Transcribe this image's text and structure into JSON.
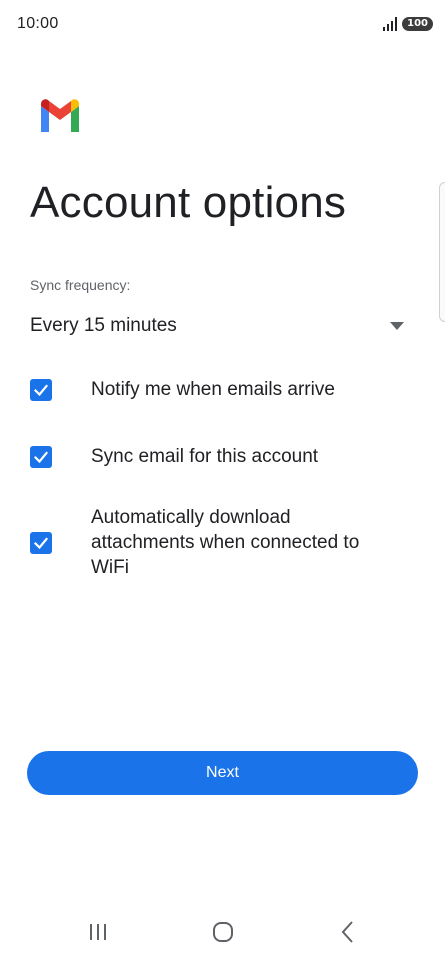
{
  "status_bar": {
    "time": "10:00",
    "battery": "100",
    "signal_icon": "signal-bars-icon"
  },
  "app": {
    "logo": "gmail-logo-icon",
    "brand_colors": [
      "#4285f4",
      "#ea4335",
      "#fbbc04",
      "#34a853",
      "#c5221f"
    ]
  },
  "page": {
    "title": "Account options"
  },
  "sync": {
    "label": "Sync frequency:",
    "value": "Every 15 minutes",
    "icon": "dropdown-arrow-icon"
  },
  "options": [
    {
      "label": "Notify me when emails arrive",
      "checked": true
    },
    {
      "label": "Sync email for this account",
      "checked": true
    },
    {
      "label": "Automatically download attachments when connected to WiFi",
      "checked": true
    }
  ],
  "next_button": {
    "label": "Next",
    "color": "#1a73e8"
  },
  "nav": {
    "recents": "recent-apps-icon",
    "home": "home-icon",
    "back": "back-icon"
  }
}
